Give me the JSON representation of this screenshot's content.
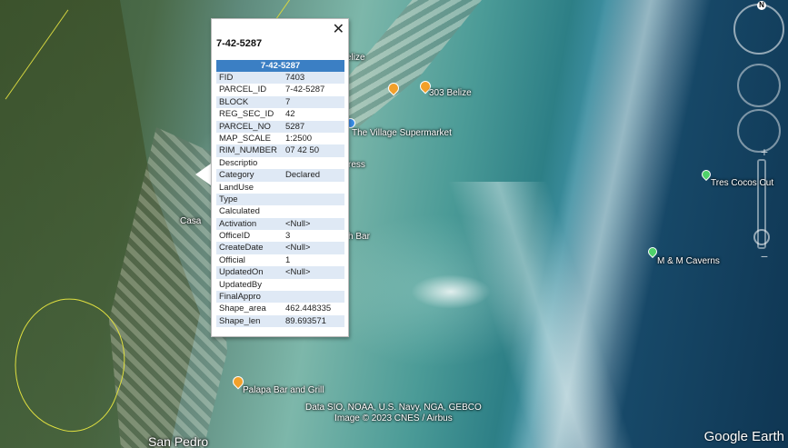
{
  "map_labels": {
    "belize_top": "elize",
    "supermarket": "The Village Supermarket",
    "place_303": "303 Belize",
    "press": "ress",
    "casa": "Casa",
    "h_bar": "h Bar",
    "tres_cocos": "Tres Cocos Cut",
    "mm_caverns": "M & M Caverns",
    "palapa": "Palapa Bar and Grill",
    "san_pedro": "San Pedro"
  },
  "attribution": {
    "line1": "Data SIO, NOAA, U.S. Navy, NGA, GEBCO",
    "line2": "Image © 2023 CNES / Airbus"
  },
  "logo": "Google Earth",
  "compass_letter": "N",
  "zoom": {
    "plus": "+",
    "minus": "−"
  },
  "balloon": {
    "close": "✕",
    "title": "7-42-5287",
    "table_header": "7-42-5287",
    "rows": [
      {
        "k": "FID",
        "v": "7403"
      },
      {
        "k": "PARCEL_ID",
        "v": "7-42-5287"
      },
      {
        "k": "BLOCK",
        "v": "7"
      },
      {
        "k": "REG_SEC_ID",
        "v": "42"
      },
      {
        "k": "PARCEL_NO",
        "v": "5287"
      },
      {
        "k": "MAP_SCALE",
        "v": "1:2500"
      },
      {
        "k": "RIM_NUMBER",
        "v": "07 42 50"
      },
      {
        "k": "Descriptio",
        "v": ""
      },
      {
        "k": "Category",
        "v": "Declared"
      },
      {
        "k": "LandUse",
        "v": ""
      },
      {
        "k": "Type",
        "v": ""
      },
      {
        "k": "Calculated",
        "v": ""
      },
      {
        "k": "Activation",
        "v": "<Null>"
      },
      {
        "k": "OfficeID",
        "v": "3"
      },
      {
        "k": "CreateDate",
        "v": "<Null>"
      },
      {
        "k": "Official",
        "v": "1"
      },
      {
        "k": "UpdatedOn",
        "v": "<Null>"
      },
      {
        "k": "UpdatedBy",
        "v": ""
      },
      {
        "k": "FinalAppro",
        "v": ""
      },
      {
        "k": "Shape_area",
        "v": "462.448335"
      },
      {
        "k": "Shape_len",
        "v": "89.693571"
      }
    ]
  }
}
